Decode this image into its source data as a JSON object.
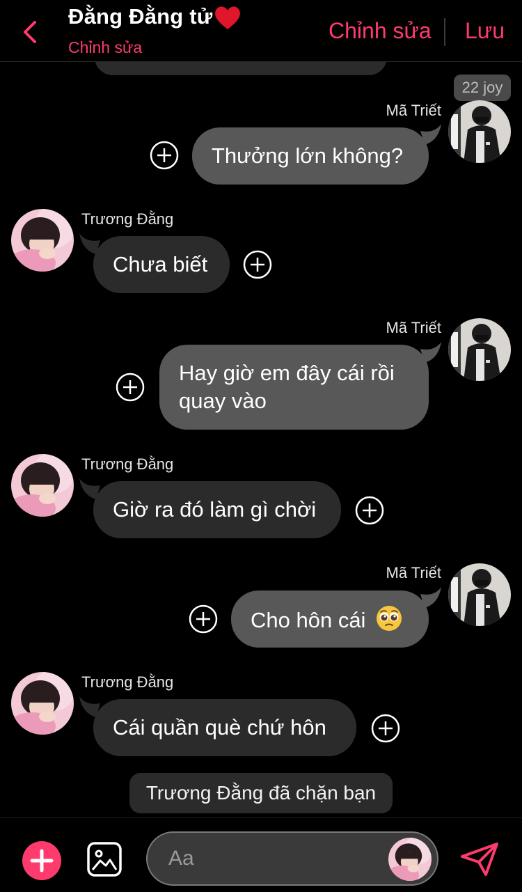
{
  "header": {
    "title": "Đằng Đằng tử",
    "subtitle": "Chỉnh sửa",
    "edit_label": "Chỉnh sửa",
    "save_label": "Lưu"
  },
  "badge": {
    "label": "22 joy"
  },
  "messages": [
    {
      "sender": "Mã Triết",
      "side": "right",
      "text_lines": [
        "Thưởng lớn không?"
      ]
    },
    {
      "sender": "Trương Đằng",
      "side": "left",
      "text_lines": [
        "Chưa biết"
      ]
    },
    {
      "sender": "Mã Triết",
      "side": "right",
      "text_lines": [
        "Hay giờ em đây cái rồi",
        "quay vào"
      ]
    },
    {
      "sender": "Trương Đằng",
      "side": "left",
      "text_lines": [
        "Giờ ra đó làm gì chời"
      ]
    },
    {
      "sender": "Mã Triết",
      "side": "right",
      "text_lines": [
        "Cho hôn cái"
      ],
      "emoji": "pleading-face"
    },
    {
      "sender": "Trương Đằng",
      "side": "left",
      "text_lines": [
        "Cái quần què chứ hôn"
      ]
    }
  ],
  "system_notice": "Trương Đằng đã chặn bạn",
  "composer": {
    "placeholder": "Aa"
  },
  "colors": {
    "accent": "#ff3b6e",
    "bubble_in": "#2b2b2b",
    "bubble_out": "#585858"
  },
  "icons": [
    "back-chevron-icon",
    "heart-icon",
    "plus-circle-icon",
    "image-icon",
    "send-icon",
    "pleading-face-emoji"
  ]
}
